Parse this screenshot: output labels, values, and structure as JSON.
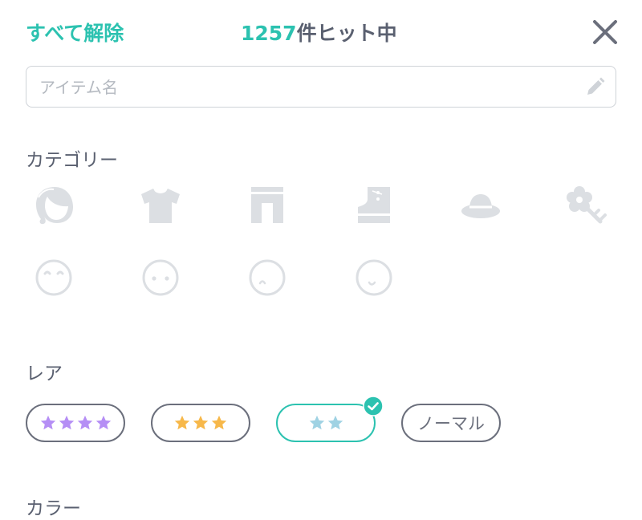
{
  "header": {
    "clear_all": "すべて解除",
    "hit_count_number": "1257",
    "hit_count_suffix": "件ヒット中"
  },
  "search": {
    "placeholder": "アイテム名",
    "value": ""
  },
  "category": {
    "title": "カテゴリー",
    "items": [
      {
        "name": "hair-icon"
      },
      {
        "name": "tops-icon"
      },
      {
        "name": "bottoms-icon"
      },
      {
        "name": "shoes-icon"
      },
      {
        "name": "hat-icon"
      },
      {
        "name": "accessory-icon"
      },
      {
        "name": "face-smile-eyes-icon"
      },
      {
        "name": "face-dot-eyes-icon"
      },
      {
        "name": "face-sad-icon"
      },
      {
        "name": "face-happy-icon"
      }
    ]
  },
  "rarity": {
    "title": "レア",
    "options": [
      {
        "stars": 4,
        "label": "",
        "selected": false
      },
      {
        "stars": 3,
        "label": "",
        "selected": false
      },
      {
        "stars": 2,
        "label": "",
        "selected": true
      },
      {
        "stars": 0,
        "label": "ノーマル",
        "selected": false
      }
    ]
  },
  "color": {
    "title": "カラー"
  },
  "colors": {
    "accent": "#2cc2b0",
    "text": "#5a6070",
    "icon_inactive": "#dcdfe3",
    "star_4": "#b58ef5",
    "star_3": "#f7b84a",
    "star_2": "#9fd2e3"
  }
}
